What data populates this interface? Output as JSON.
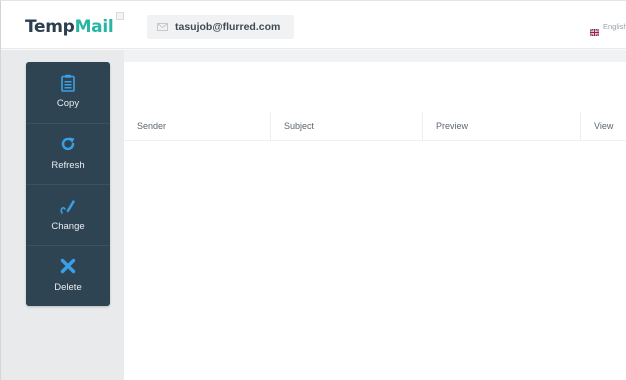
{
  "header": {
    "logo_temp": "Temp",
    "logo_mail": "Mail",
    "email": "tasujob@flurred.com",
    "email_icon": "envelope-icon",
    "language": "English",
    "language_icon": "uk-flag-icon"
  },
  "sidebar": {
    "items": [
      {
        "label": "Copy",
        "icon": "clipboard-icon"
      },
      {
        "label": "Refresh",
        "icon": "refresh-icon"
      },
      {
        "label": "Change",
        "icon": "edit-icon"
      },
      {
        "label": "Delete",
        "icon": "close-icon"
      }
    ]
  },
  "inbox": {
    "columns": [
      "Sender",
      "Subject",
      "Preview",
      "View"
    ],
    "rows": []
  },
  "colors": {
    "brand_dark": "#2c3e50",
    "brand_accent": "#27b6a4",
    "sidebar_bg": "#2f4453",
    "icon_blue": "#3aa0e6"
  }
}
